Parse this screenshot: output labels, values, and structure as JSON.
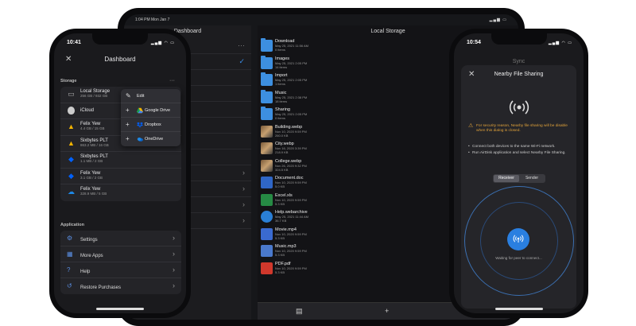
{
  "ipad": {
    "time": "1:04 PM Mon Jan 7",
    "left_title": "Dashboard",
    "right_title": "Local Storage",
    "files": [
      {
        "name": "Download",
        "meta1": "May 25, 2021 11:56 AM",
        "meta2": "0 items",
        "kind": "folder"
      },
      {
        "name": "Images",
        "meta1": "May 25, 2021 2:05 PM",
        "meta2": "14 items",
        "kind": "folder"
      },
      {
        "name": "Import",
        "meta1": "May 25, 2021 2:05 PM",
        "meta2": "1 items",
        "kind": "folder"
      },
      {
        "name": "Music",
        "meta1": "May 25, 2021 2:38 PM",
        "meta2": "18 items",
        "kind": "folder"
      },
      {
        "name": "Sharing",
        "meta1": "May 25, 2021 2:05 PM",
        "meta2": "0 items",
        "kind": "folder"
      },
      {
        "name": "Building.webp",
        "meta1": "Nov 10, 2020 9:59 PM",
        "meta2": "260.0 KB",
        "kind": "img"
      },
      {
        "name": "City.webp",
        "meta1": "Nov 16, 2020 3:39 PM",
        "meta2": "218.9 KB",
        "kind": "img"
      },
      {
        "name": "College.webp",
        "meta1": "Nov 26, 2020 9:32 PM",
        "meta2": "324.5 KB",
        "kind": "img"
      },
      {
        "name": "Document.doc",
        "meta1": "Nov 10, 2020 9:59 PM",
        "meta2": "5.0 KB",
        "kind": "doc"
      },
      {
        "name": "Excel.xls",
        "meta1": "Nov 10, 2020 9:59 PM",
        "meta2": "5.3 KB",
        "kind": "xls"
      },
      {
        "name": "Help.webarchive",
        "meta1": "May 25, 2021 11:44 AM",
        "meta2": "36.7 KB",
        "kind": "web"
      },
      {
        "name": "Movie.mp4",
        "meta1": "Nov 10, 2020 9:59 PM",
        "meta2": "5.3 KB",
        "kind": "mp4"
      },
      {
        "name": "Music.mp3",
        "meta1": "Nov 10, 2020 9:59 PM",
        "meta2": "5.3 KB",
        "kind": "mp3"
      },
      {
        "name": "PDF.pdf",
        "meta1": "Nov 10, 2020 9:59 PM",
        "meta2": "5.3 KB",
        "kind": "pdf"
      }
    ],
    "toolbar_icons": [
      "sidebar-icon",
      "plus-icon"
    ]
  },
  "left_phone": {
    "time": "10:41",
    "title": "Dashboard",
    "storage_label": "Storage",
    "storage": [
      {
        "title": "Local Storage",
        "sub": "256 GB / 932 GB",
        "icon": "drive-icon"
      },
      {
        "title": "iCloud",
        "sub": "",
        "icon": "apple-icon"
      },
      {
        "title": "Felix Yew",
        "sub": "4.4 GB / 15 GB",
        "icon": "google-drive-icon"
      },
      {
        "title": "Sixbytes PLT",
        "sub": "863.2 MB / 16 GB",
        "icon": "google-drive-icon"
      },
      {
        "title": "Sixbytes PLT",
        "sub": "1.1 MB / 2 GB",
        "icon": "dropbox-icon"
      },
      {
        "title": "Felix Yew",
        "sub": "3.1 GB / 2 GB",
        "icon": "dropbox-icon"
      },
      {
        "title": "Felix Yew",
        "sub": "328.9 MB / 5 GB",
        "icon": "onedrive-icon"
      }
    ],
    "app_label": "Application",
    "app": [
      {
        "label": "Settings",
        "icon": "gear-icon"
      },
      {
        "label": "More Apps",
        "icon": "grid-icon"
      },
      {
        "label": "Help",
        "icon": "help-icon"
      },
      {
        "label": "Restore Purchases",
        "icon": "restore-icon"
      }
    ],
    "popover": {
      "edit": "Edit",
      "items": [
        "Google Drive",
        "Dropbox",
        "OneDrive"
      ]
    }
  },
  "right_phone": {
    "time": "10:54",
    "behind_title": "Sync",
    "title": "Nearby File Sharing",
    "warning": "For security reason, Nearby file sharing will be disable when this dialog is closed.",
    "bullets": [
      "Connect both devices to the same Wi-Fi network.",
      "Run AirDisk application and select Nearby File Sharing."
    ],
    "segments": [
      "Receiver",
      "Sender"
    ],
    "waiting": "Waiting for peer to connect..."
  },
  "colors": {
    "accent": "#2a7fe0",
    "warning": "#e0a23a",
    "folder": "#3d8fe0"
  }
}
